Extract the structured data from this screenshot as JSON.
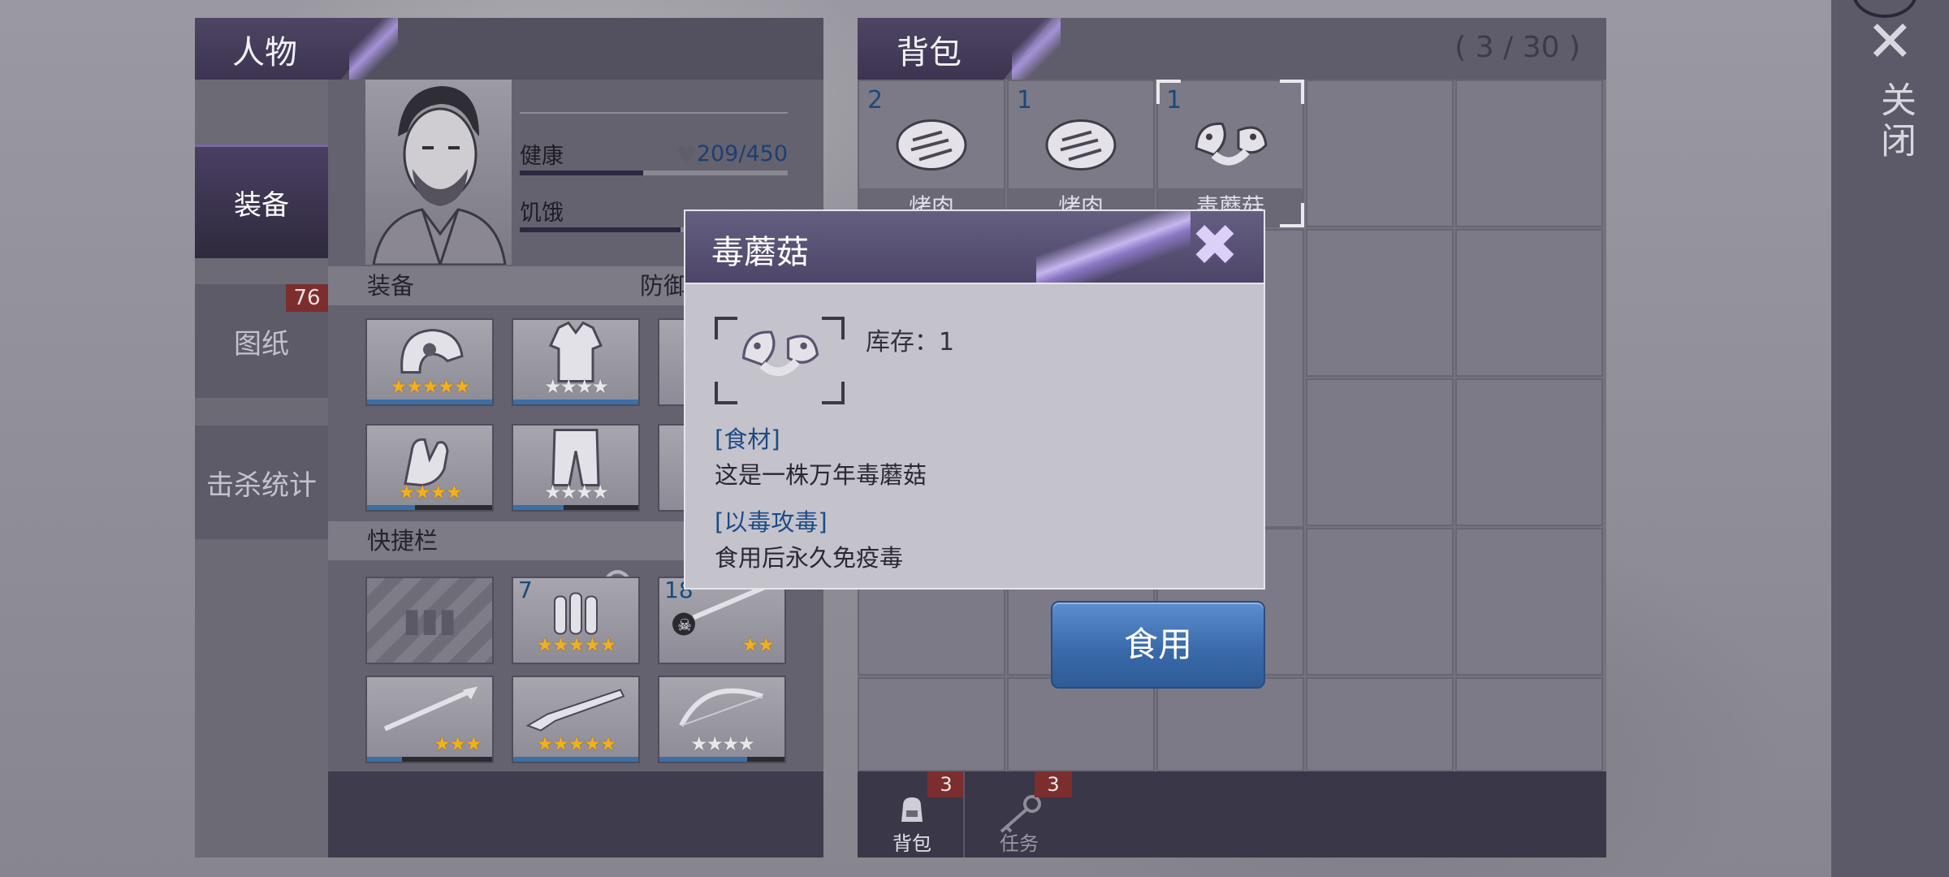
{
  "character": {
    "header": "人物",
    "tabs": [
      {
        "label": "装备",
        "active": true
      },
      {
        "label": "图纸",
        "badge": "76"
      },
      {
        "label": "击杀统计"
      }
    ],
    "stats": {
      "health_label": "健康",
      "health_value": "209/450",
      "health_fraction": 0.46,
      "hunger_label": "饥饿",
      "hunger_fraction": 0.6
    },
    "equipment_section": "装备",
    "defense_label": "防御",
    "hotbar_section": "快捷栏",
    "equipment_slots": [
      {
        "icon": "helmet-icon",
        "stars_gold": 5,
        "stars_white": 0,
        "durability": 1.0
      },
      {
        "icon": "jacket-icon",
        "stars_gold": 0,
        "stars_white": 4,
        "durability": 1.0
      },
      {
        "icon": "gloves-icon",
        "stars_gold": 4,
        "stars_white": 0,
        "durability": 0.38
      },
      {
        "icon": "pants-icon",
        "stars_gold": 0,
        "stars_white": 4,
        "durability": 0.4
      }
    ],
    "hotbar_slots": [
      {
        "icon": "empty-slot-icon",
        "count": ""
      },
      {
        "icon": "bullets-icon",
        "count": "7",
        "stars_gold": 5,
        "stars_white": 0
      },
      {
        "icon": "pirate-sword-icon",
        "count": "18",
        "stars_gold": 2,
        "stars_white": 0
      },
      {
        "icon": "spear-icon",
        "count": "",
        "stars_gold": 3,
        "stars_white": 0,
        "durability": 0.28
      },
      {
        "icon": "shotgun-icon",
        "count": "",
        "stars_gold": 5,
        "stars_white": 0,
        "durability": 1.0
      },
      {
        "icon": "bow-icon",
        "count": "",
        "stars_gold": 0,
        "stars_white": 4,
        "durability": 0.7
      }
    ]
  },
  "backpack": {
    "header": "背包",
    "capacity": "( 3 / 30 )",
    "items": [
      {
        "count": "2",
        "name": "烤肉",
        "icon": "steak-icon"
      },
      {
        "count": "1",
        "name": "烤肉",
        "icon": "steak-icon"
      },
      {
        "count": "1",
        "name": "毒蘑菇",
        "icon": "mushroom-icon",
        "selected": true
      }
    ],
    "footer_tabs": [
      {
        "label": "背包",
        "badge": "3",
        "icon": "backpack-icon"
      },
      {
        "label": "任务",
        "badge": "3",
        "icon": "key-icon"
      }
    ]
  },
  "close": {
    "label": "关闭"
  },
  "modal": {
    "title": "毒蘑菇",
    "stock": "库存：1",
    "tag1": "[食材]",
    "text1": "这是一株万年毒蘑菇",
    "tag2": "[以毒攻毒]",
    "text2": "食用后永久免疫毒",
    "action": "食用"
  },
  "colors": {
    "accent_blue": "#3a6aaa",
    "badge_red": "#7c2e2f",
    "panel_purple": "#4d4668"
  }
}
